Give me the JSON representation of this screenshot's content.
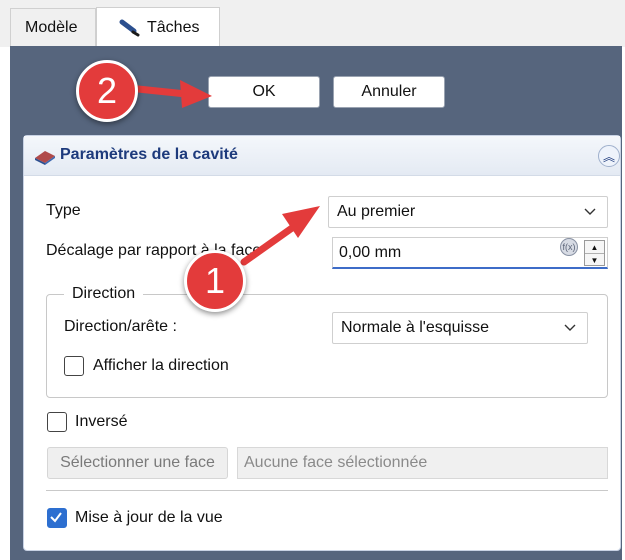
{
  "tabs": [
    {
      "label": "Modèle"
    },
    {
      "label": "Tâches",
      "icon": "pencil-ruler-icon"
    }
  ],
  "dialog": {
    "ok_label": "OK",
    "cancel_label": "Annuler"
  },
  "group": {
    "title": "Paramètres de la cavité",
    "icon": "cavity-icon",
    "type_label": "Type",
    "type_value": "Au premier",
    "offset_label": "Décalage par rapport à la face",
    "offset_value": "0,00 mm",
    "direction": {
      "legend": "Direction",
      "edge_label": "Direction/arête :",
      "edge_value": "Normale à l'esquisse",
      "show_label": "Afficher la direction",
      "show_checked": false
    },
    "reversed_label": "Inversé",
    "reversed_checked": false,
    "select_face_label": "Sélectionner une face",
    "face_placeholder": "Aucune face sélectionnée",
    "update_view_label": "Mise à jour de la vue",
    "update_view_checked": true
  },
  "annotations": {
    "callout_1": "1",
    "callout_2": "2",
    "color": "#e33b3b"
  },
  "colors": {
    "panel_bg": "#56657d",
    "accent": "#2d6fd0",
    "title": "#1d3a7c"
  }
}
